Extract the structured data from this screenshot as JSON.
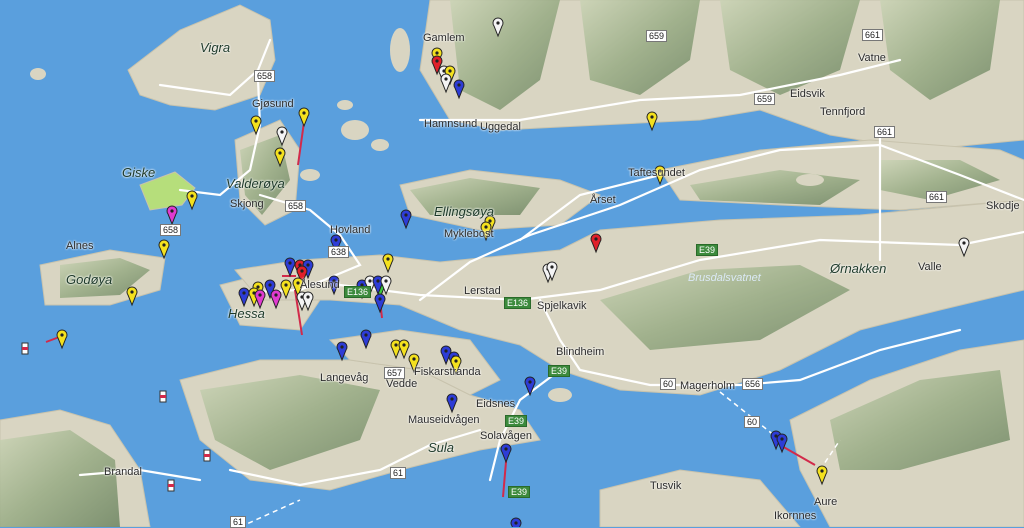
{
  "map": {
    "water_color": "#5a9fdd",
    "land_color": "#d9d5c2",
    "terrain_color": "#9db389",
    "road_color": "#ffffff",
    "route_color": "#d22a4a",
    "highlight_island_color": "#b6de7b"
  },
  "place_labels": [
    "Vigra",
    "Gjøsund",
    "Giske",
    "Valderøya",
    "Skjong",
    "Alnes",
    "Godøya",
    "Hessa",
    "Gamlem",
    "Hamnsund",
    "Uggedal",
    "Eidsvik",
    "Vatne",
    "Tennfjord",
    "Taftesundet",
    "Ellingsøya",
    "Myklebost",
    "Årset",
    "Hovland",
    "Lerstad",
    "Spjelkavik",
    "Blindheim",
    "Skodje",
    "Valle",
    "Ørnakken",
    "Brusdalsvatnet",
    "Langevåg",
    "Fiskarstranda",
    "Vedde",
    "Eidsnes",
    "Mauseidvågen",
    "Sula",
    "Solavågen",
    "Magerholm",
    "Brandal",
    "Tusvik",
    "Aure",
    "Ikornnes",
    "Ålesund"
  ],
  "road_shields": [
    "658",
    "658",
    "658",
    "638",
    "659",
    "659",
    "661",
    "661",
    "661",
    "657",
    "656",
    "60",
    "60",
    "61",
    "61",
    "E39",
    "E39",
    "E39",
    "E39",
    "E136",
    "E136"
  ],
  "markers": {
    "yellow": "#f4e11e",
    "white": "#f4f4f4",
    "blue": "#2d3cd6",
    "red": "#e0202a",
    "magenta": "#e03ad0",
    "green": "#3ac83a"
  }
}
